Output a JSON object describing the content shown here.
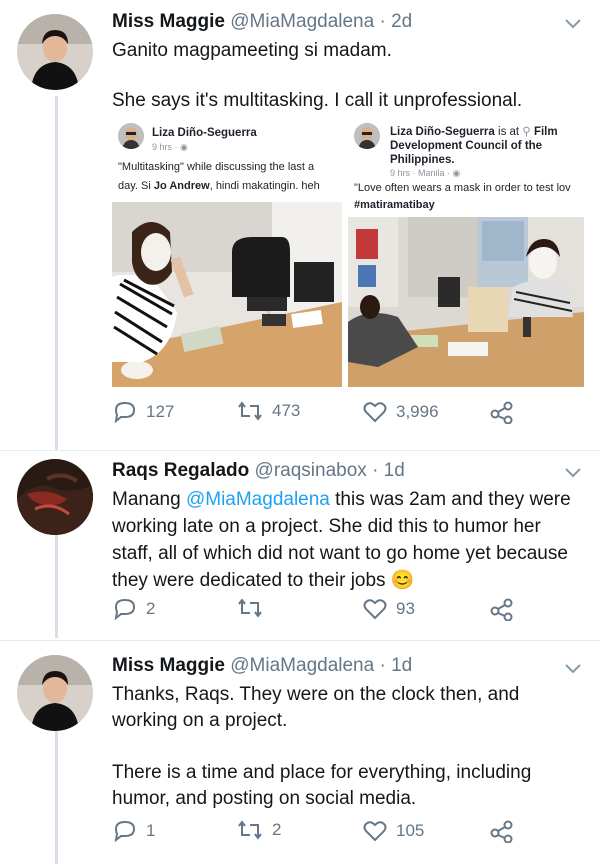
{
  "tweets": [
    {
      "name": "Miss Maggie",
      "handle": "@MiaMagdalena",
      "time": "· 2d",
      "lines": [
        "Ganito magpameeting si madam.",
        "She says it's multitasking. I call it unprofessional."
      ],
      "replies": "127",
      "retweets": "473",
      "likes": "3,996"
    },
    {
      "name": "Raqs Regalado",
      "handle": "@raqsinabox",
      "time": "· 1d",
      "text_before": "Manang ",
      "mention": "@MiaMagdalena",
      "text_after": " this was 2am and they were working late on a project. She did this to humor her staff, all of which did not want to go home yet because they were dedicated to their jobs ",
      "emoji": "😊",
      "replies": "2",
      "retweets": "",
      "likes": "93"
    },
    {
      "name": "Miss Maggie",
      "handle": "@MiaMagdalena",
      "time": "· 1d",
      "para1": "Thanks, Raqs. They were on the clock then, and working on a project.",
      "para2": "There is a time and place for everything, including humor, and posting on social media.",
      "replies": "1",
      "retweets": "2",
      "likes": "105"
    }
  ],
  "embeds": {
    "left": {
      "name": "Liza Diño-Seguerra",
      "meta": "9 hrs ·",
      "line1": "\"Multitasking\" while discussing the last a",
      "line2_name": "Jo Andrew",
      "line2_pre": "day. Si ",
      "line2_post": ", hindi makatingin. heh"
    },
    "right": {
      "name": "Liza Diño-Seguerra",
      "is_at": " is at ",
      "place1": "Film",
      "place2": "Development Council of the",
      "place3": "Philippines.",
      "meta": "9 hrs · Manila ·",
      "line1": "\"Love often wears a mask in order to test lov",
      "line2": "#matiramatibay"
    }
  },
  "colors": {
    "accent": "#1da1f2",
    "muted": "#657786",
    "divider": "#e6ecf0"
  }
}
